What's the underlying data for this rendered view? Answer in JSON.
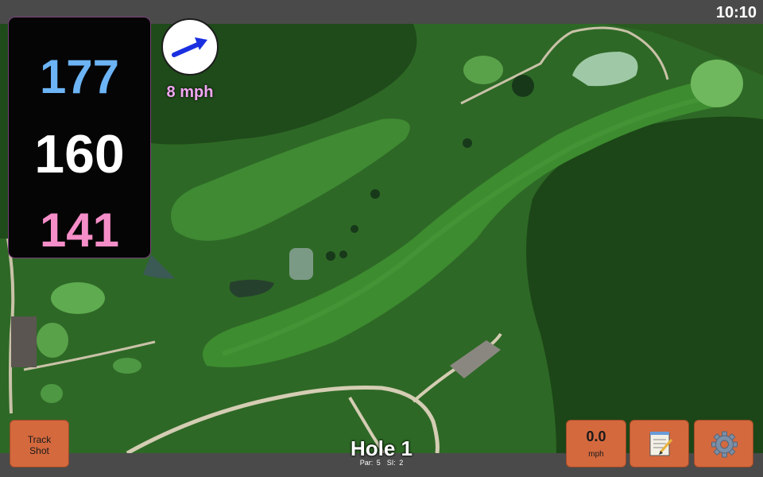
{
  "status_bar": {
    "time": "10:10"
  },
  "distances": {
    "back": "177",
    "middle": "160",
    "front": "141"
  },
  "wind": {
    "speed_label": "8 mph",
    "icon": "wind-arrow-icon"
  },
  "hole": {
    "title": "Hole 1",
    "par_label": "Par: 5",
    "si_label": "SI: 2"
  },
  "buttons": {
    "track_shot_line1": "Track",
    "track_shot_line2": "Shot",
    "wind_value": "0.0",
    "wind_unit": "mph",
    "notes_icon": "notepad-icon",
    "settings_icon": "gear-icon"
  },
  "colors": {
    "back_distance": "#6cb4f5",
    "middle_distance": "#ffffff",
    "front_distance": "#f58ec8",
    "button": "#d4693e",
    "wind_arrow": "#1a2fe0"
  }
}
